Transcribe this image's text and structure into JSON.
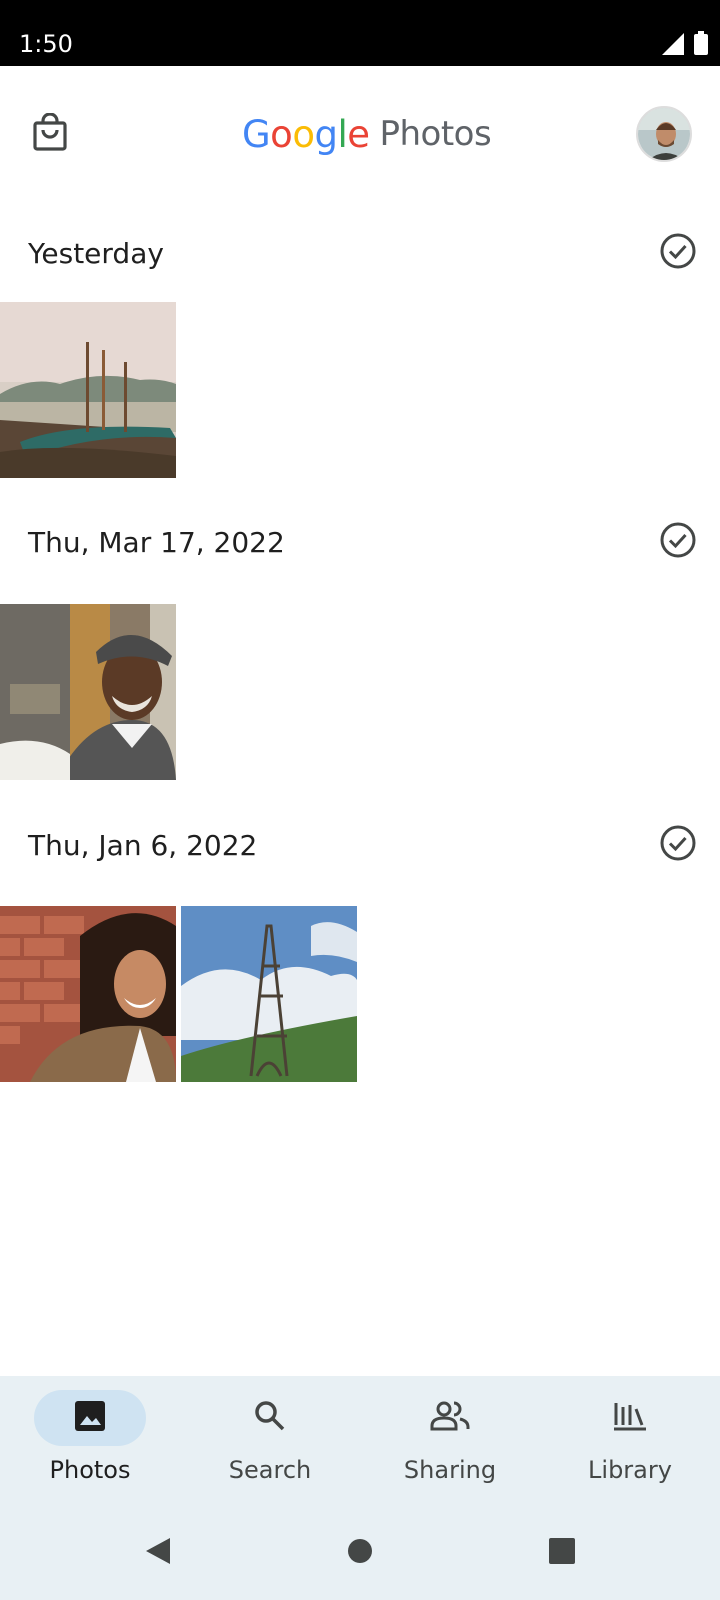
{
  "status_bar": {
    "time": "1:50"
  },
  "app_bar": {
    "logo_letters": [
      "G",
      "o",
      "o",
      "g",
      "l",
      "e"
    ],
    "logo_suffix": "Photos",
    "shop_icon": "shopping-bag-icon",
    "avatar_icon": "user-avatar"
  },
  "sections": [
    {
      "title": "Yesterday"
    },
    {
      "title": "Thu, Mar 17, 2022"
    },
    {
      "title": "Thu, Jan 6, 2022"
    }
  ],
  "bottom_nav": {
    "items": [
      {
        "label": "Photos",
        "icon": "photo-icon",
        "active": true
      },
      {
        "label": "Search",
        "icon": "search-icon",
        "active": false
      },
      {
        "label": "Sharing",
        "icon": "people-icon",
        "active": false
      },
      {
        "label": "Library",
        "icon": "library-icon",
        "active": false
      }
    ]
  },
  "colors": {
    "nav_background": "#e8f0f4",
    "nav_active_pill": "#cfe3f2",
    "google_blue": "#4285F4",
    "google_red": "#EA4335",
    "google_yellow": "#FBBC05",
    "google_green": "#34A853"
  }
}
